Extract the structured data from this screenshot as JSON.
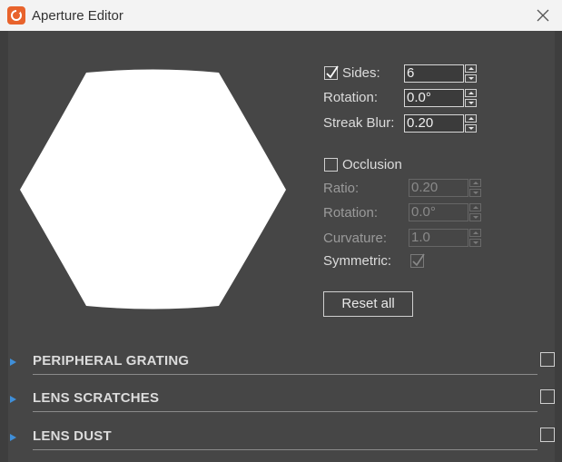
{
  "window": {
    "title": "Aperture Editor"
  },
  "aperture": {
    "sides": {
      "label": "Sides:",
      "checked": true,
      "value": "6"
    },
    "rotation": {
      "label": "Rotation:",
      "value": "0.0°"
    },
    "streak_blur": {
      "label": "Streak Blur:",
      "value": "0.20"
    }
  },
  "occlusion": {
    "label": "Occlusion",
    "checked": false,
    "ratio": {
      "label": "Ratio:",
      "value": "0.20"
    },
    "rotation": {
      "label": "Rotation:",
      "value": "0.0°"
    },
    "curvature": {
      "label": "Curvature:",
      "value": "1.0"
    },
    "symmetric": {
      "label": "Symmetric:",
      "checked": true
    }
  },
  "reset_label": "Reset all",
  "sections": [
    {
      "title": "PERIPHERAL GRATING",
      "checked": false
    },
    {
      "title": "LENS SCRATCHES",
      "checked": false
    },
    {
      "title": "LENS DUST",
      "checked": false
    }
  ],
  "colors": {
    "background": "#464646",
    "titlebar": "#f3f3f3",
    "accent": "#3f8fd9",
    "app_icon": "#e8632c"
  }
}
